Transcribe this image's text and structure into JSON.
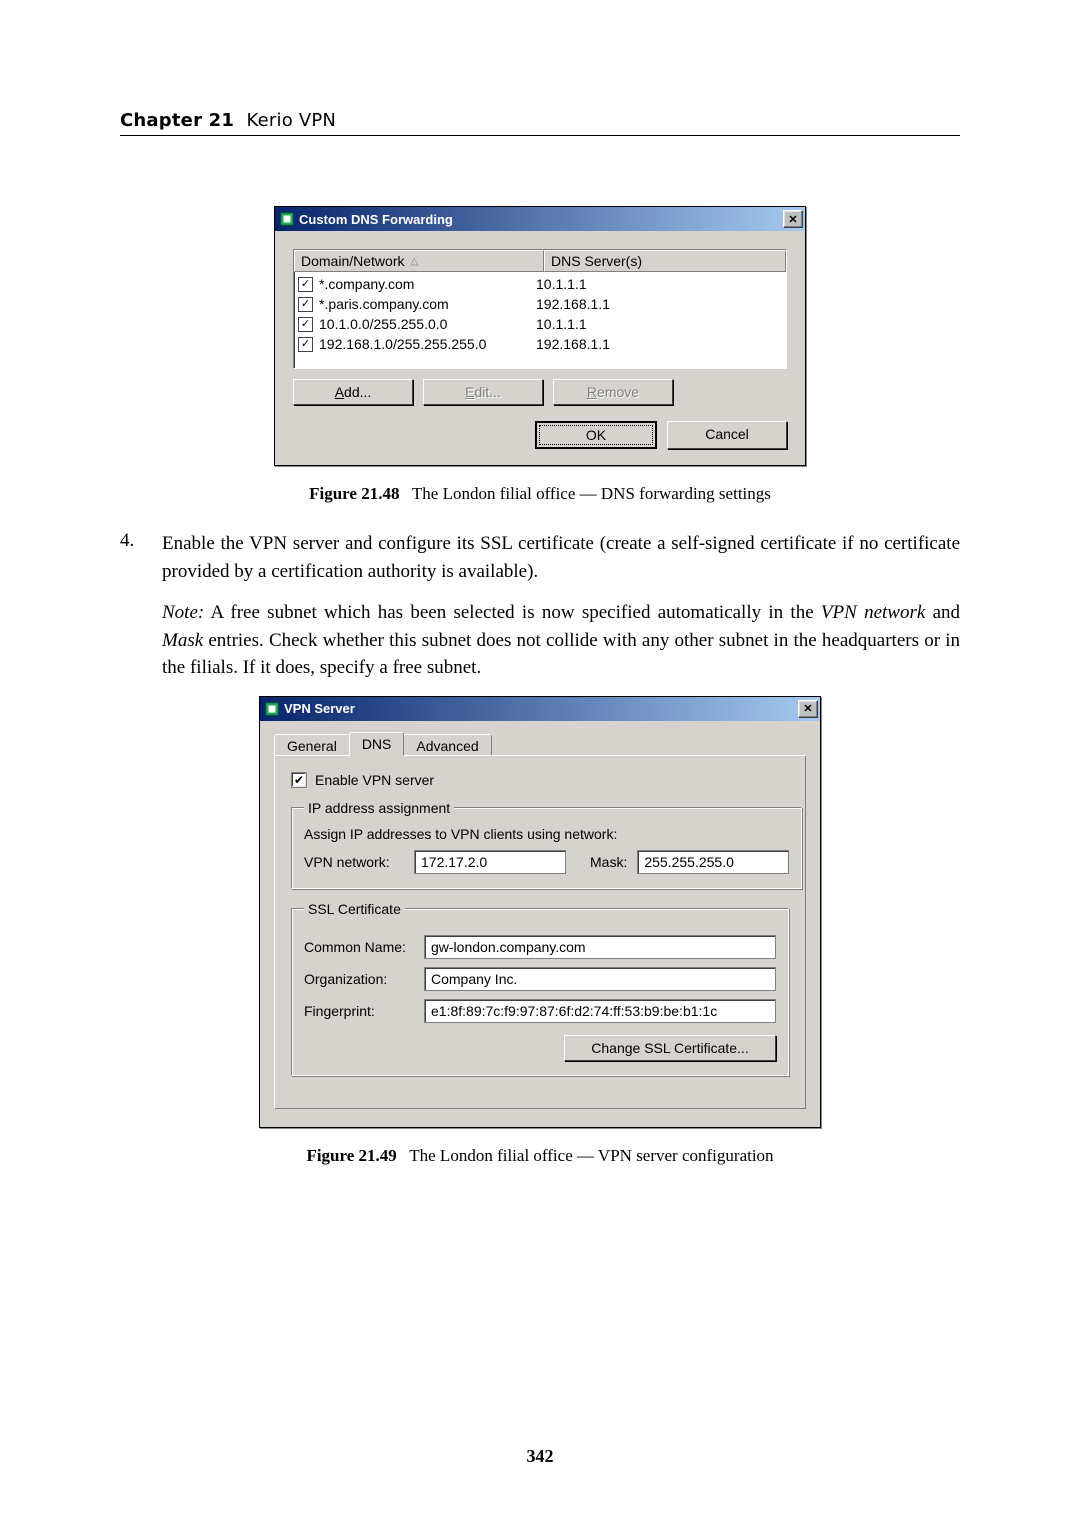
{
  "chapter": {
    "label": "Chapter 21",
    "title": "Kerio VPN"
  },
  "page_number": "342",
  "dlg1": {
    "title": "Custom DNS Forwarding",
    "columns": {
      "domain": "Domain/Network",
      "servers": "DNS Server(s)"
    },
    "rows": [
      {
        "domain": "*.company.com",
        "server": "10.1.1.1"
      },
      {
        "domain": "*.paris.company.com",
        "server": "192.168.1.1"
      },
      {
        "domain": "10.1.0.0/255.255.0.0",
        "server": "10.1.1.1"
      },
      {
        "domain": "192.168.1.0/255.255.255.0",
        "server": "192.168.1.1"
      }
    ],
    "buttons": {
      "add": "Add...",
      "edit": "Edit...",
      "remove": "Remove",
      "ok": "OK",
      "cancel": "Cancel"
    }
  },
  "fig1_caption_label": "Figure 21.48",
  "fig1_caption_text": "The London filial office — DNS forwarding settings",
  "list": {
    "num": "4.",
    "para1": "Enable the VPN server and configure its SSL certificate (create a self-signed certificate if no certificate provided by a certification authority is available).",
    "note_label": "Note:",
    "para2": "A free subnet which has been selected is now specified automatically in the VPN network and Mask entries. Check whether this subnet does not collide with any other subnet in the headquarters or in the filials. If it does, specify a free subnet."
  },
  "dlg2": {
    "title": "VPN Server",
    "tabs": {
      "general": "General",
      "dns": "DNS",
      "advanced": "Advanced"
    },
    "enable_label": "Enable VPN server",
    "ipgroup": {
      "legend": "IP address assignment",
      "assign_label": "Assign IP addresses to VPN clients using network:",
      "vpn_label": "VPN network:",
      "vpn_value": "172.17.2.0",
      "mask_label": "Mask:",
      "mask_value": "255.255.255.0"
    },
    "sslgroup": {
      "legend": "SSL Certificate",
      "cn_label": "Common Name:",
      "cn_value": "gw-london.company.com",
      "org_label": "Organization:",
      "org_value": "Company Inc.",
      "fp_label": "Fingerprint:",
      "fp_value": "e1:8f:89:7c:f9:97:87:6f:d2:74:ff:53:b9:be:b1:1c",
      "change_btn": "Change SSL Certificate..."
    }
  },
  "fig2_caption_label": "Figure 21.49",
  "fig2_caption_text": "The London filial office — VPN server configuration"
}
